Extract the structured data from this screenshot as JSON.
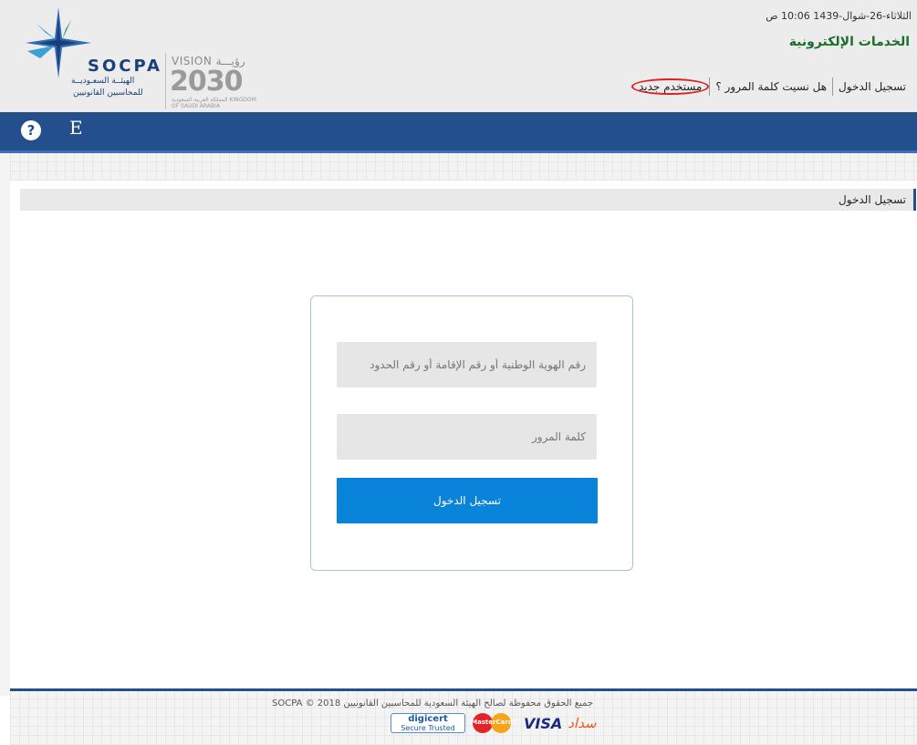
{
  "header": {
    "date": "الثلاثاء-26-شوال-1439 10:06 ص",
    "eservices_title": "الخدمات الإلكترونية",
    "nav": {
      "login": "تسجيل الدخول",
      "forgot_password": "هل نسيت كلمة المرور ؟",
      "new_user": "مستخدم جديد"
    },
    "logo": {
      "socpa": "SOCPA",
      "socpa_ar_1": "الهيئــة السعـوديــة",
      "socpa_ar_2": "للمحاسبين القانونيين",
      "vision_title": "VISION رؤيـــة",
      "vision_year": "2030",
      "vision_sub": "المملكة العربية السعودية KINGDOM OF SAUDI ARABIA"
    }
  },
  "toolbar": {
    "help_icon": "question-circle-icon",
    "language_label": "E"
  },
  "breadcrumb": {
    "current": "تسجيل الدخول"
  },
  "login_form": {
    "id_placeholder": "رقم الهوية الوطنية أو رقم الإقامة أو رقم الحدود",
    "password_placeholder": "كلمة المرور",
    "submit_label": "تسجيل الدخول"
  },
  "footer": {
    "copyright": "جميع الحقوق محفوظة لصالح الهيئة السعودية للمحاسبين القانونيين 2018 © SOCPA",
    "badges": {
      "digicert": "digicert",
      "digicert_sub": "Secure Trusted",
      "mastercard": "MasterCard",
      "visa": "VISA",
      "sadad": "سداد"
    }
  },
  "colors": {
    "primary_blue": "#234f8c",
    "button_blue": "#0a84db",
    "title_green": "#1b6d2a",
    "highlight_red": "#e01f1f"
  }
}
